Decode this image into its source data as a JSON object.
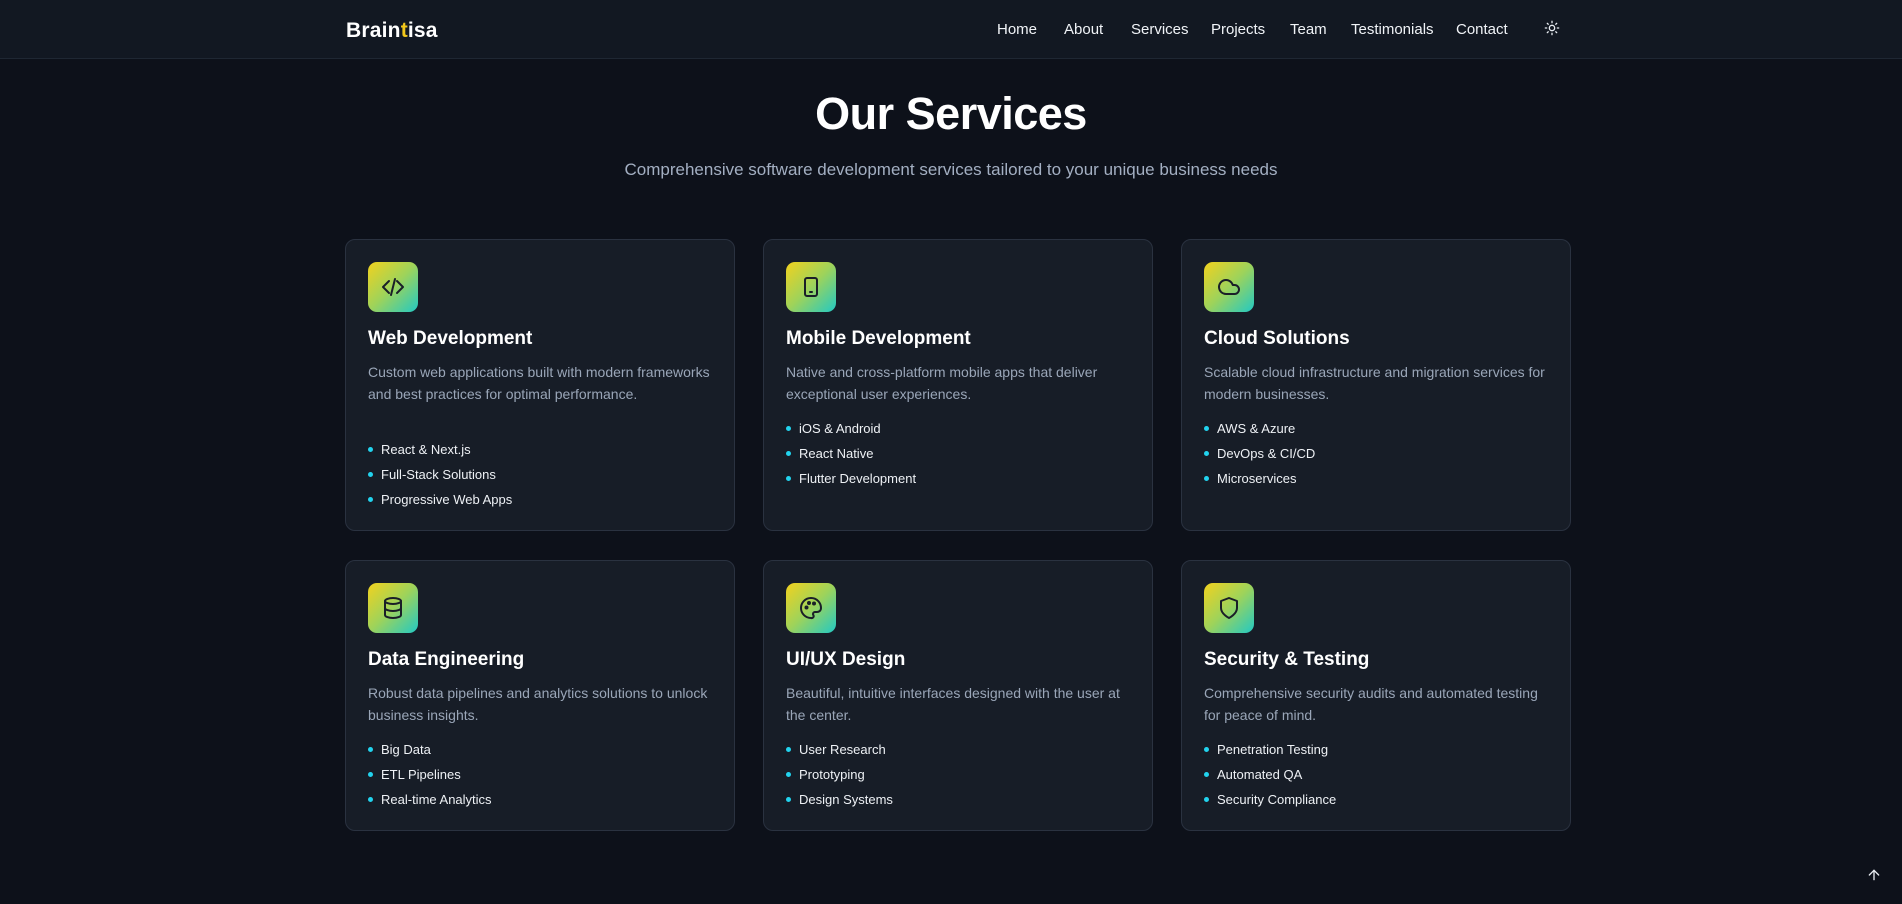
{
  "brand": {
    "prefix": "Brain",
    "accent": "t",
    "suffix": "isa",
    "accent_color": "#f2c71b"
  },
  "nav": {
    "items": [
      {
        "label": "Home"
      },
      {
        "label": "About"
      },
      {
        "label": "Services"
      },
      {
        "label": "Projects"
      },
      {
        "label": "Team"
      },
      {
        "label": "Testimonials"
      },
      {
        "label": "Contact"
      }
    ],
    "theme_toggle_icon": "sun-icon"
  },
  "services": {
    "title": "Our Services",
    "subtitle": "Comprehensive software development services tailored to your unique business needs",
    "cards": [
      {
        "icon": "code-icon",
        "title": "Web Development",
        "description": "Custom web applications built with modern frameworks and best practices for optimal performance.",
        "features": [
          "React & Next.js",
          "Full-Stack Solutions",
          "Progressive Web Apps"
        ]
      },
      {
        "icon": "tablet-icon",
        "title": "Mobile Development",
        "description": "Native and cross-platform mobile apps that deliver exceptional user experiences.",
        "features": [
          "iOS & Android",
          "React Native",
          "Flutter Development"
        ]
      },
      {
        "icon": "cloud-icon",
        "title": "Cloud Solutions",
        "description": "Scalable cloud infrastructure and migration services for modern businesses.",
        "features": [
          "AWS & Azure",
          "DevOps & CI/CD",
          "Microservices"
        ]
      },
      {
        "icon": "database-icon",
        "title": "Data Engineering",
        "description": "Robust data pipelines and analytics solutions to unlock business insights.",
        "features": [
          "Big Data",
          "ETL Pipelines",
          "Real-time Analytics"
        ]
      },
      {
        "icon": "palette-icon",
        "title": "UI/UX Design",
        "description": "Beautiful, intuitive interfaces designed with the user at the center.",
        "features": [
          "User Research",
          "Prototyping",
          "Design Systems"
        ]
      },
      {
        "icon": "shield-icon",
        "title": "Security & Testing",
        "description": "Comprehensive security audits and automated testing for peace of mind.",
        "features": [
          "Penetration Testing",
          "Automated QA",
          "Security Compliance"
        ]
      }
    ]
  },
  "scroll_top_icon": "arrow-up-icon",
  "colors": {
    "background": "#0d111a",
    "card": "#171d27",
    "bullet": "#22d3ee",
    "icon_gradient": [
      "#f2d21e",
      "#22c9c4"
    ]
  }
}
